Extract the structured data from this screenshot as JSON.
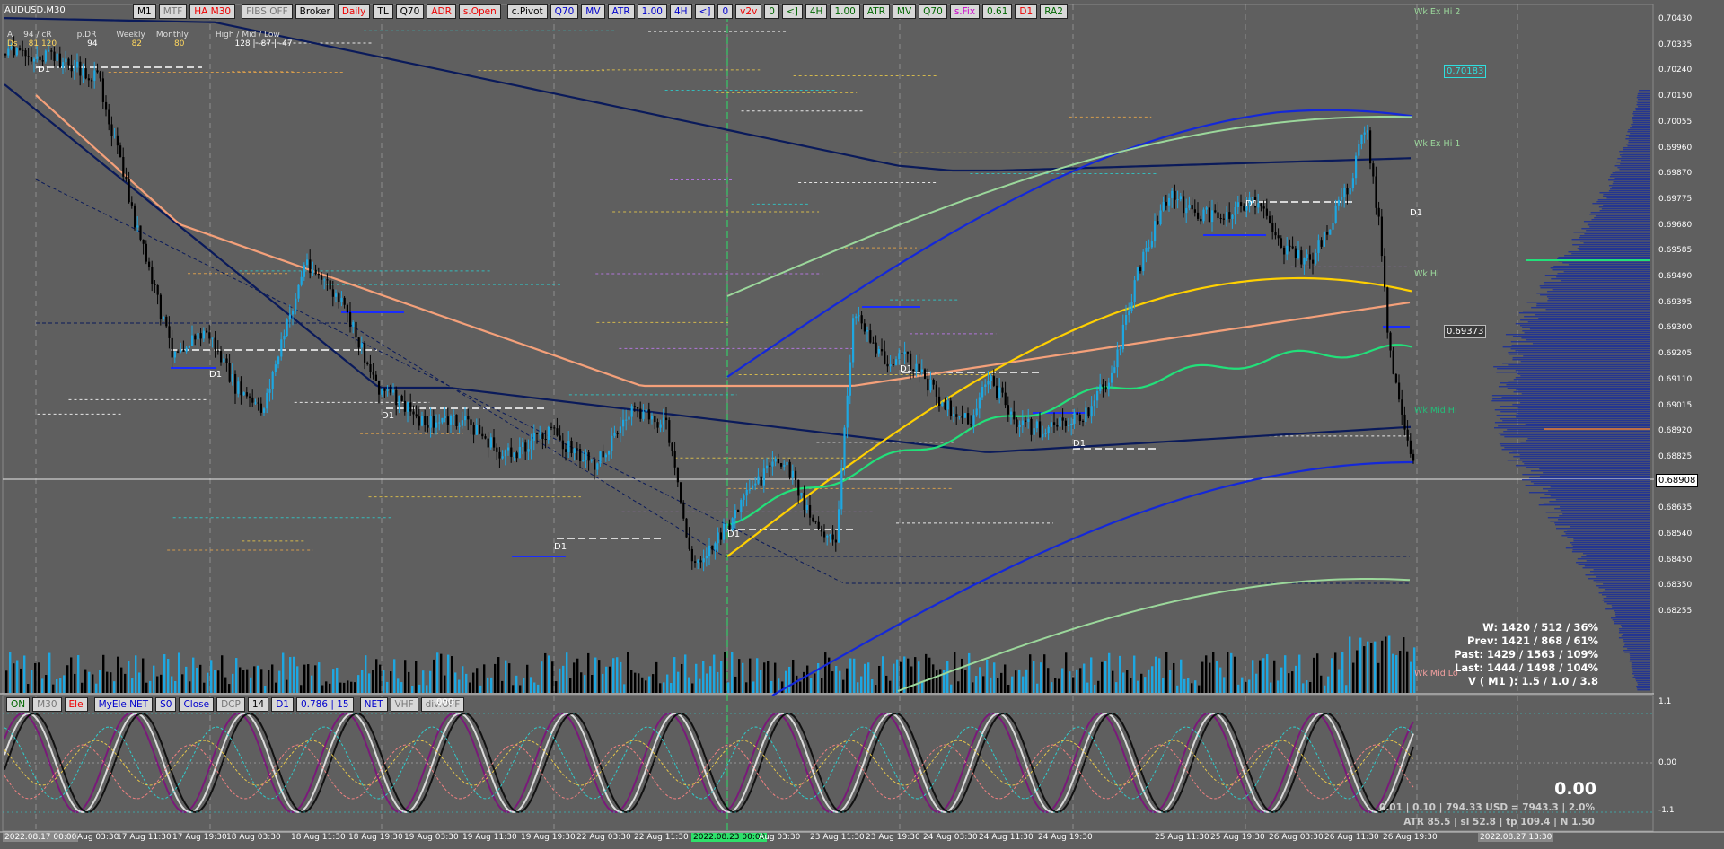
{
  "symbol_label": "AUDUSD,M30",
  "toolbar": [
    {
      "label": "M1",
      "color": "#000"
    },
    {
      "label": "MTF",
      "color": "#777"
    },
    {
      "label": "HA M30",
      "color": "#e00"
    },
    {
      "label": "FIBS OFF",
      "color": "#777"
    },
    {
      "label": "Broker",
      "color": "#000"
    },
    {
      "label": "Daily",
      "color": "#e00"
    },
    {
      "label": "TL",
      "color": "#000"
    },
    {
      "label": "Q70",
      "color": "#000"
    },
    {
      "label": "ADR",
      "color": "#e00"
    },
    {
      "label": "s.Open",
      "color": "#e00"
    },
    {
      "label": "c.Pivot",
      "color": "#000"
    },
    {
      "label": "Q70",
      "color": "#00c"
    },
    {
      "label": "MV",
      "color": "#00c"
    },
    {
      "label": "ATR",
      "color": "#00c"
    },
    {
      "label": "1.00",
      "color": "#00c"
    },
    {
      "label": "4H",
      "color": "#00c"
    },
    {
      "label": "<]",
      "color": "#00c"
    },
    {
      "label": "0",
      "color": "#00c"
    },
    {
      "label": "v2v",
      "color": "#e00"
    },
    {
      "label": "0",
      "color": "#060"
    },
    {
      "label": "<]",
      "color": "#060"
    },
    {
      "label": "4H",
      "color": "#060"
    },
    {
      "label": "1.00",
      "color": "#060"
    },
    {
      "label": "ATR",
      "color": "#060"
    },
    {
      "label": "MV",
      "color": "#060"
    },
    {
      "label": "Q70",
      "color": "#060"
    },
    {
      "label": "s.Fix",
      "color": "#c0c"
    },
    {
      "label": "0.61",
      "color": "#060"
    },
    {
      "label": "D1",
      "color": "#e00"
    },
    {
      "label": "RA2",
      "color": "#060"
    }
  ],
  "legend": {
    "rows": [
      {
        "a": "A",
        "b": "94 / cR",
        "c": "p.DR",
        "d": "Weekly",
        "e": "Monthly",
        "f": "High / Mid / Low"
      },
      {
        "a": "Ds",
        "b": "81  120",
        "c": "94",
        "d": "82",
        "e": "80",
        "f": "128  |  -87  |  -47"
      }
    ]
  },
  "price_scale": [
    "0.70430",
    "0.70335",
    "0.70240",
    "0.70150",
    "0.70055",
    "0.69960",
    "0.69870",
    "0.69775",
    "0.69680",
    "0.69585",
    "0.69490",
    "0.69395",
    "0.69300",
    "0.69205",
    "0.69110",
    "0.69015",
    "0.68920",
    "0.68825",
    "0.68730",
    "0.68635",
    "0.68540",
    "0.68450",
    "0.68350",
    "0.68255"
  ],
  "current_price": "0.68908",
  "price_tags": [
    {
      "label": "0.70183"
    },
    {
      "label": "0.69373"
    }
  ],
  "right_labels": [
    "Wk Ex Hi 2",
    "Wk Ex Hi 1",
    "Wk Hi",
    "Wk Mid Hi",
    "Wk Mid Lo"
  ],
  "day_labels": [
    "D1",
    "D1",
    "D1",
    "D1",
    "D1",
    "D1",
    "D1",
    "D1",
    "D1",
    "D1"
  ],
  "time_scale": [
    "2022.08.17 00:00",
    "Aug 03:30",
    "17 Aug 11:30",
    "17 Aug 19:30",
    "18 Aug 03:30",
    "18 Aug 11:30",
    "18 Aug 19:30",
    "19 Aug 03:30",
    "19 Aug 11:30",
    "19 Aug 19:30",
    "22 Aug 03:30",
    "22 Aug 11:30",
    "2022.08.23 00:00",
    "Aug 03:30",
    "23 Aug 11:30",
    "23 Aug 19:30",
    "24 Aug 03:30",
    "24 Aug 11:30",
    "24 Aug 19:30",
    "25 Aug 11:30",
    "25 Aug 19:30",
    "26 Aug 03:30",
    "26 Aug 11:30",
    "26 Aug 19:30",
    "2022.08.27 13:30"
  ],
  "stats": [
    "W: 1420 / 512 / 36%",
    "Prev: 1421 / 868 / 61%",
    "Past: 1429 / 1563 / 109%",
    "Last: 1444 / 1498 / 104%",
    "V ( M1 ): 1.5 / 1.0 / 3.8"
  ],
  "indicator_bar": [
    {
      "label": "ON",
      "color": "#060"
    },
    {
      "label": "M30",
      "color": "#777"
    },
    {
      "label": "Ele",
      "color": "#e00"
    },
    {
      "label": "MyEle.NET",
      "color": "#00c"
    },
    {
      "label": "S0",
      "color": "#00c"
    },
    {
      "label": "Close",
      "color": "#00c"
    },
    {
      "label": "DCP",
      "color": "#777"
    },
    {
      "label": "14",
      "color": "#000"
    },
    {
      "label": "D1",
      "color": "#00c"
    },
    {
      "label": "0.786 | 15",
      "color": "#00c"
    },
    {
      "label": "NET",
      "color": "#00c"
    },
    {
      "label": "VHF",
      "color": "#777"
    },
    {
      "label": "div.OFF",
      "color": "#777"
    }
  ],
  "indicator_suffix": "000",
  "osc_scale": [
    "1.1",
    "0.00",
    "-1.1"
  ],
  "bottom_info": {
    "value": "0.00",
    "line1": "0.01  |  0.10  |  794.33 USD = 7943.3  |  2.0%",
    "line2": "ATR 85.5  |  sl 52.8  |  tp 109.4  |  N 1.50"
  },
  "colors": {
    "background": "#5f5f5f",
    "candle_up": "#1ea7e1",
    "candle_down": "#000000",
    "ema": "#f4a07a",
    "yellow": "#ffd000",
    "green": "#22e07a"
  }
}
